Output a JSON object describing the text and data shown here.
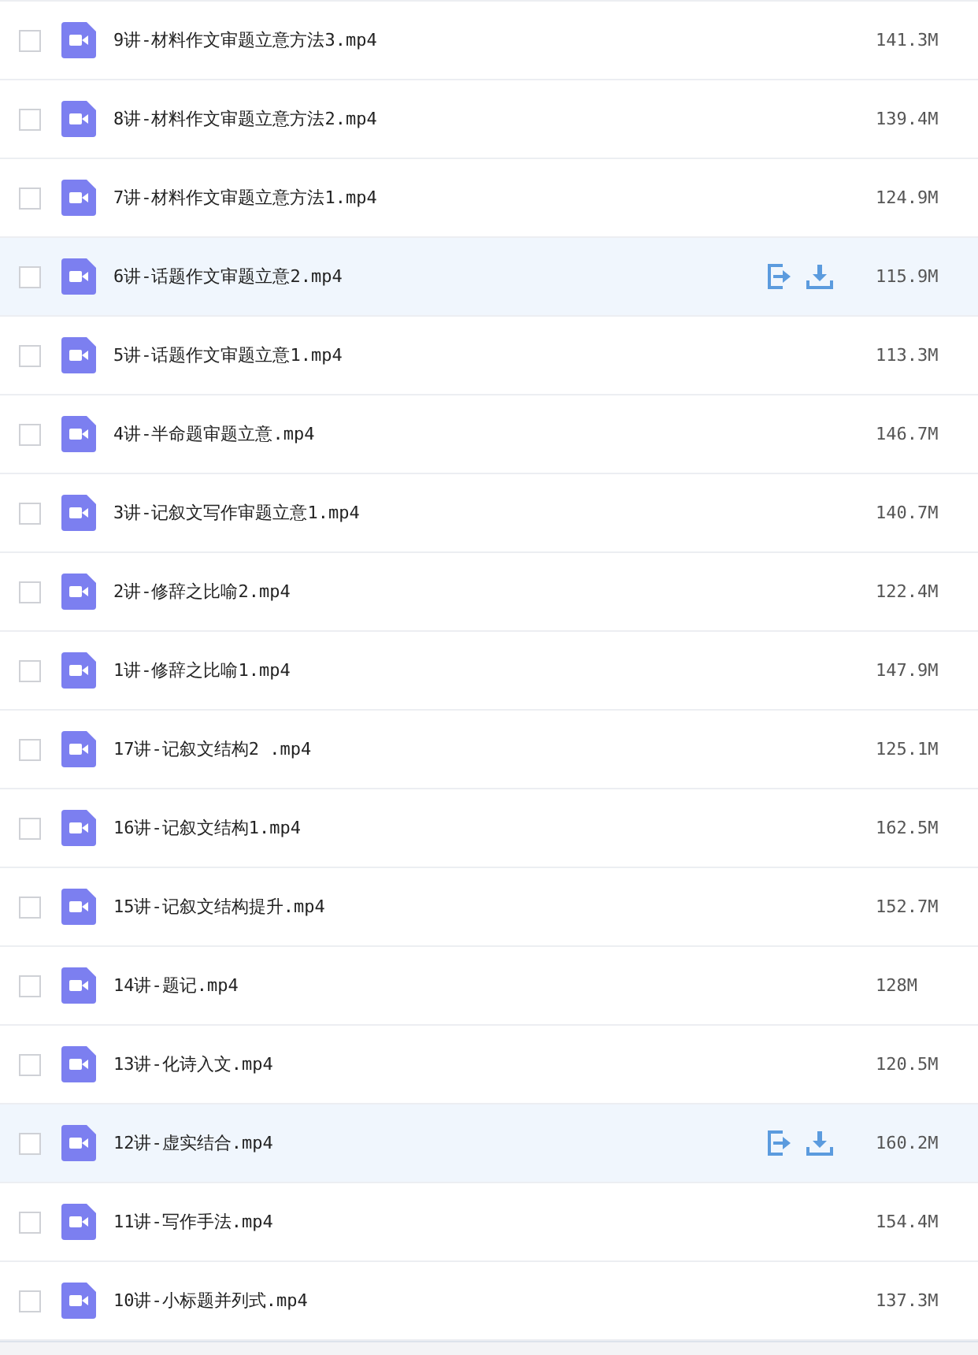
{
  "files": [
    {
      "name": "9讲-材料作文审题立意方法3.mp4",
      "size": "141.3M",
      "checked": false,
      "highlighted": false
    },
    {
      "name": "8讲-材料作文审题立意方法2.mp4",
      "size": "139.4M",
      "checked": false,
      "highlighted": false
    },
    {
      "name": "7讲-材料作文审题立意方法1.mp4",
      "size": "124.9M",
      "checked": false,
      "highlighted": false
    },
    {
      "name": "6讲-话题作文审题立意2.mp4",
      "size": "115.9M",
      "checked": false,
      "highlighted": true
    },
    {
      "name": "5讲-话题作文审题立意1.mp4",
      "size": "113.3M",
      "checked": false,
      "highlighted": false
    },
    {
      "name": "4讲-半命题审题立意.mp4",
      "size": "146.7M",
      "checked": false,
      "highlighted": false
    },
    {
      "name": "3讲-记叙文写作审题立意1.mp4",
      "size": "140.7M",
      "checked": false,
      "highlighted": false
    },
    {
      "name": "2讲-修辞之比喻2.mp4",
      "size": "122.4M",
      "checked": false,
      "highlighted": false
    },
    {
      "name": "1讲-修辞之比喻1.mp4",
      "size": "147.9M",
      "checked": false,
      "highlighted": false
    },
    {
      "name": "17讲-记叙文结构2 .mp4",
      "size": "125.1M",
      "checked": false,
      "highlighted": false
    },
    {
      "name": "16讲-记叙文结构1.mp4",
      "size": "162.5M",
      "checked": false,
      "highlighted": false
    },
    {
      "name": "15讲-记叙文结构提升.mp4",
      "size": "152.7M",
      "checked": false,
      "highlighted": false
    },
    {
      "name": "14讲-题记.mp4",
      "size": "128M",
      "checked": false,
      "highlighted": false
    },
    {
      "name": "13讲-化诗入文.mp4",
      "size": "120.5M",
      "checked": false,
      "highlighted": false
    },
    {
      "name": "12讲-虚实结合.mp4",
      "size": "160.2M",
      "checked": false,
      "highlighted": true
    },
    {
      "name": "11讲-写作手法.mp4",
      "size": "154.4M",
      "checked": false,
      "highlighted": false
    },
    {
      "name": "10讲-小标题并列式.mp4",
      "size": "137.3M",
      "checked": false,
      "highlighted": false
    }
  ]
}
